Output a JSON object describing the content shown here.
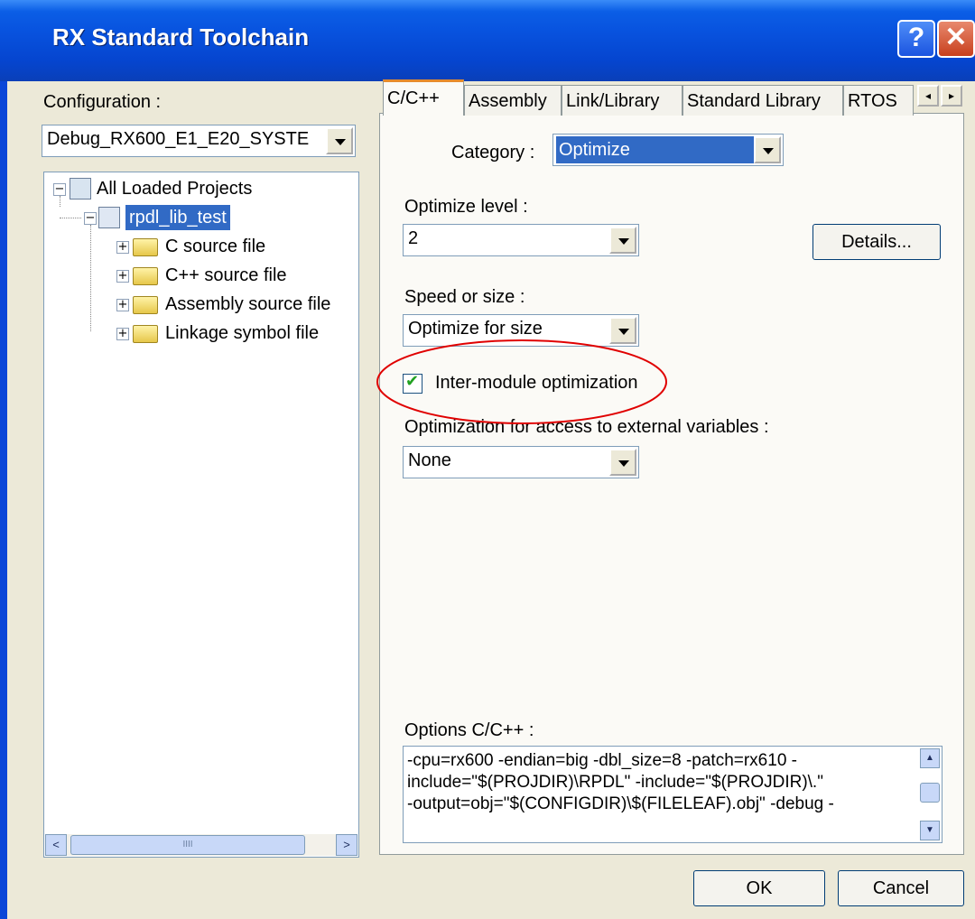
{
  "window": {
    "title": "RX Standard Toolchain",
    "help_glyph": "?",
    "close_glyph": "✕"
  },
  "left": {
    "config_label": "Configuration :",
    "config_value": "Debug_RX600_E1_E20_SYSTE",
    "tree": {
      "root": "All Loaded Projects",
      "project": "rpdl_lib_test",
      "folders": [
        "C source file",
        "C++ source file",
        "Assembly source file",
        "Linkage symbol file"
      ]
    },
    "scroll_left": "<",
    "scroll_right": ">",
    "scroll_grip": "IIII"
  },
  "tabs": [
    "C/C++",
    "Assembly",
    "Link/Library",
    "Standard Library",
    "RTOS"
  ],
  "tab_nav": {
    "left": "◂",
    "right": "▸"
  },
  "content": {
    "category_label": "Category :",
    "category_value": "Optimize",
    "optimize_level_label": "Optimize level :",
    "optimize_level_value": "2",
    "details_button": "Details...",
    "speed_label": "Speed or size :",
    "speed_value": "Optimize for size",
    "intermodule_label": "Inter-module optimization",
    "intermodule_checked": true,
    "external_label": "Optimization for access to external variables :",
    "external_value": "None",
    "options_label": "Options C/C++ :",
    "options_lines": [
      "-cpu=rx600 -endian=big -dbl_size=8 -patch=rx610 -",
      "include=\"$(PROJDIR)\\RPDL\" -include=\"$(PROJDIR)\\.\"",
      "-output=obj=\"$(CONFIGDIR)\\$(FILELEAF).obj\" -debug -"
    ]
  },
  "buttons": {
    "ok": "OK",
    "cancel": "Cancel"
  },
  "colors": {
    "title_bar": "#0852de",
    "dialog_bg": "#ece9d8",
    "selection": "#316ac5",
    "annotation_circle": "#e00000",
    "active_tab_accent": "#e68b2c"
  }
}
